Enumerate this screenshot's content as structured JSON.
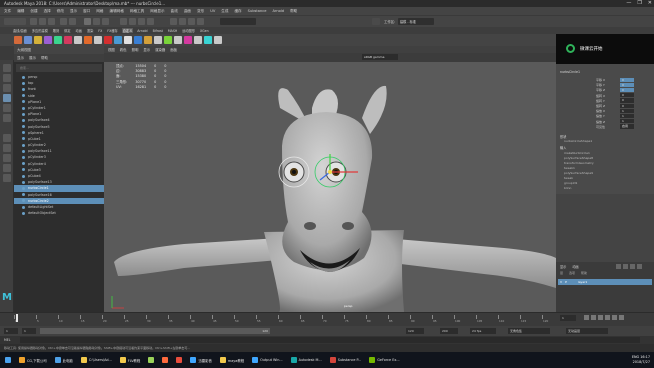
{
  "window": {
    "title": "Autodesk Maya 2018: C:\\Users\\Administrator\\Desktop\\ma.mb* --- nurbsCircle1...",
    "controls": [
      "—",
      "❐",
      "✕"
    ]
  },
  "menubar": {
    "items": [
      "文件",
      "编辑",
      "创建",
      "选择",
      "修改",
      "显示",
      "窗口",
      "网格",
      "编辑网格",
      "网格工具",
      "网格显示",
      "曲线",
      "曲面",
      "变形",
      "UV",
      "生成",
      "缓存",
      "Substance",
      "Arnold",
      "帮助"
    ],
    "workspace_label": "工作区:",
    "workspace_value": "建模 - 标准"
  },
  "shelf": {
    "tabs": [
      "曲线/曲面",
      "多边形建模",
      "雕刻",
      "绑定",
      "动画",
      "渲染",
      "FX",
      "FX缓存",
      "自定义",
      "Arnold",
      "Bifrost",
      "MASH",
      "运动图形",
      "XGen"
    ],
    "active_tab": "自定义"
  },
  "outliner": {
    "title": "大纲视图",
    "menu": [
      "显示",
      "展示",
      "帮助"
    ],
    "search_placeholder": "搜索...",
    "items": [
      {
        "label": "persp",
        "selected": false
      },
      {
        "label": "top",
        "selected": false
      },
      {
        "label": "front",
        "selected": false
      },
      {
        "label": "side",
        "selected": false
      },
      {
        "label": "pPlane1",
        "selected": false
      },
      {
        "label": "pCylinder1",
        "selected": false
      },
      {
        "label": "pPlane1",
        "selected": false
      },
      {
        "label": "polySurface4",
        "selected": false
      },
      {
        "label": "polySurface5",
        "selected": false
      },
      {
        "label": "pSphere1",
        "selected": false
      },
      {
        "label": "pCube1",
        "selected": false
      },
      {
        "label": "pCylinder2",
        "selected": false
      },
      {
        "label": "polySurface11",
        "selected": false
      },
      {
        "label": "pCylinder3",
        "selected": false
      },
      {
        "label": "pCylinder4",
        "selected": false
      },
      {
        "label": "pCube3",
        "selected": false
      },
      {
        "label": "pCube4",
        "selected": false
      },
      {
        "label": "polySurface13",
        "selected": false
      },
      {
        "label": "nurbsCircle1",
        "selected": true
      },
      {
        "label": "polySurface16",
        "selected": false
      },
      {
        "label": "nurbsCircle2",
        "selected": true
      },
      {
        "label": "defaultLightSet",
        "selected": false
      },
      {
        "label": "defaultObjectSet",
        "selected": false
      }
    ]
  },
  "viewport": {
    "menu": [
      "视图",
      "着色",
      "照明",
      "显示",
      "渲染器",
      "面板"
    ],
    "hud": [
      [
        "顶点:",
        "15504",
        "0",
        "0"
      ],
      [
        "边:",
        "30883",
        "0",
        "0"
      ],
      [
        "面:",
        "15380",
        "0",
        "0"
      ],
      [
        "三角形:",
        "30770",
        "0",
        "0"
      ],
      [
        "UV:",
        "16281",
        "0",
        "0"
      ]
    ],
    "color_space": "sRGB gamma",
    "camera": "persp"
  },
  "brand": {
    "text": "微课云开始",
    "accent": "#2fb35a"
  },
  "channel_box": {
    "node_name": "nurbsCircle1",
    "tabs": [
      "通道",
      "编辑",
      "对象",
      "显示"
    ],
    "channels": [
      {
        "name": "平移 X",
        "value": "0"
      },
      {
        "name": "平移 Y",
        "value": "0"
      },
      {
        "name": "平移 Z",
        "value": "0"
      },
      {
        "name": "旋转 X",
        "value": "0"
      },
      {
        "name": "旋转 Y",
        "value": "0"
      },
      {
        "name": "旋转 Z",
        "value": "0"
      },
      {
        "name": "缩放 X",
        "value": "1"
      },
      {
        "name": "缩放 Y",
        "value": "1"
      },
      {
        "name": "缩放 Z",
        "value": "1"
      },
      {
        "name": "可见性",
        "value": "启用"
      }
    ],
    "shape_label": "形状",
    "shape_name": "nurbsCircleShape1",
    "inputs_label": "输入",
    "inputs": [
      "makeNurbCircle1",
      "polySurfaceShape8",
      "transformGeometry",
      "tweak1",
      "polySurfaceShape9",
      "tweak",
      "groupId1",
      "blinn"
    ]
  },
  "layers": {
    "tabs": [
      "显示",
      "动画"
    ],
    "menu": [
      "层",
      "选项",
      "帮助"
    ],
    "layer_name": "layer1",
    "layer_flags": [
      "V",
      "P"
    ]
  },
  "timeline": {
    "ticks": [
      "1",
      "5",
      "10",
      "15",
      "20",
      "25",
      "30",
      "35",
      "40",
      "45",
      "50",
      "55",
      "60",
      "65",
      "70",
      "75",
      "80",
      "85",
      "90",
      "95",
      "100",
      "105",
      "110",
      "115",
      "120"
    ],
    "current_frame": "1",
    "range_start": "1",
    "range_inner_start": "1",
    "range_inner_end": "120",
    "range_end_a": "120",
    "range_end_b": "200",
    "char_set": "无角色集",
    "anim_layer": "无动画层",
    "fps": "24 fps"
  },
  "command_line": {
    "label": "MEL"
  },
  "help_line": {
    "text": "移动工具: 使用操纵器移动对象。Ctrl+中键单击可沿着操纵器轴移动对象。Shift+中键拖动可沿着约束平面移动。Ctrl+Shift+左键单击可..."
  },
  "taskbar": {
    "items": [
      {
        "label": "CG,下载公司",
        "color": "#f0a22c"
      },
      {
        "label": "此电脑",
        "color": "#4ea1e8"
      },
      {
        "label": "C:\\Users\\Ad...",
        "color": "#f2c94c"
      },
      {
        "label": "FLV教程",
        "color": "#f2c94c"
      },
      {
        "label": "",
        "color": "#9bd35a"
      },
      {
        "label": "",
        "color": "#ff6a3d"
      },
      {
        "label": "",
        "color": "#e84d3d"
      },
      {
        "label": "迅雷影音",
        "color": "#3fa7ff"
      },
      {
        "label": "maya教程",
        "color": "#f2c94c"
      },
      {
        "label": "Output Win...",
        "color": "#3fa7ff"
      },
      {
        "label": "Autodesk M...",
        "color": "#19a8a8"
      },
      {
        "label": "Substance P...",
        "color": "#d4453b"
      },
      {
        "label": "GeForce Ex...",
        "color": "#76b900"
      }
    ],
    "lang": "ENG",
    "time": "16:17",
    "date": "2018/7/27"
  }
}
